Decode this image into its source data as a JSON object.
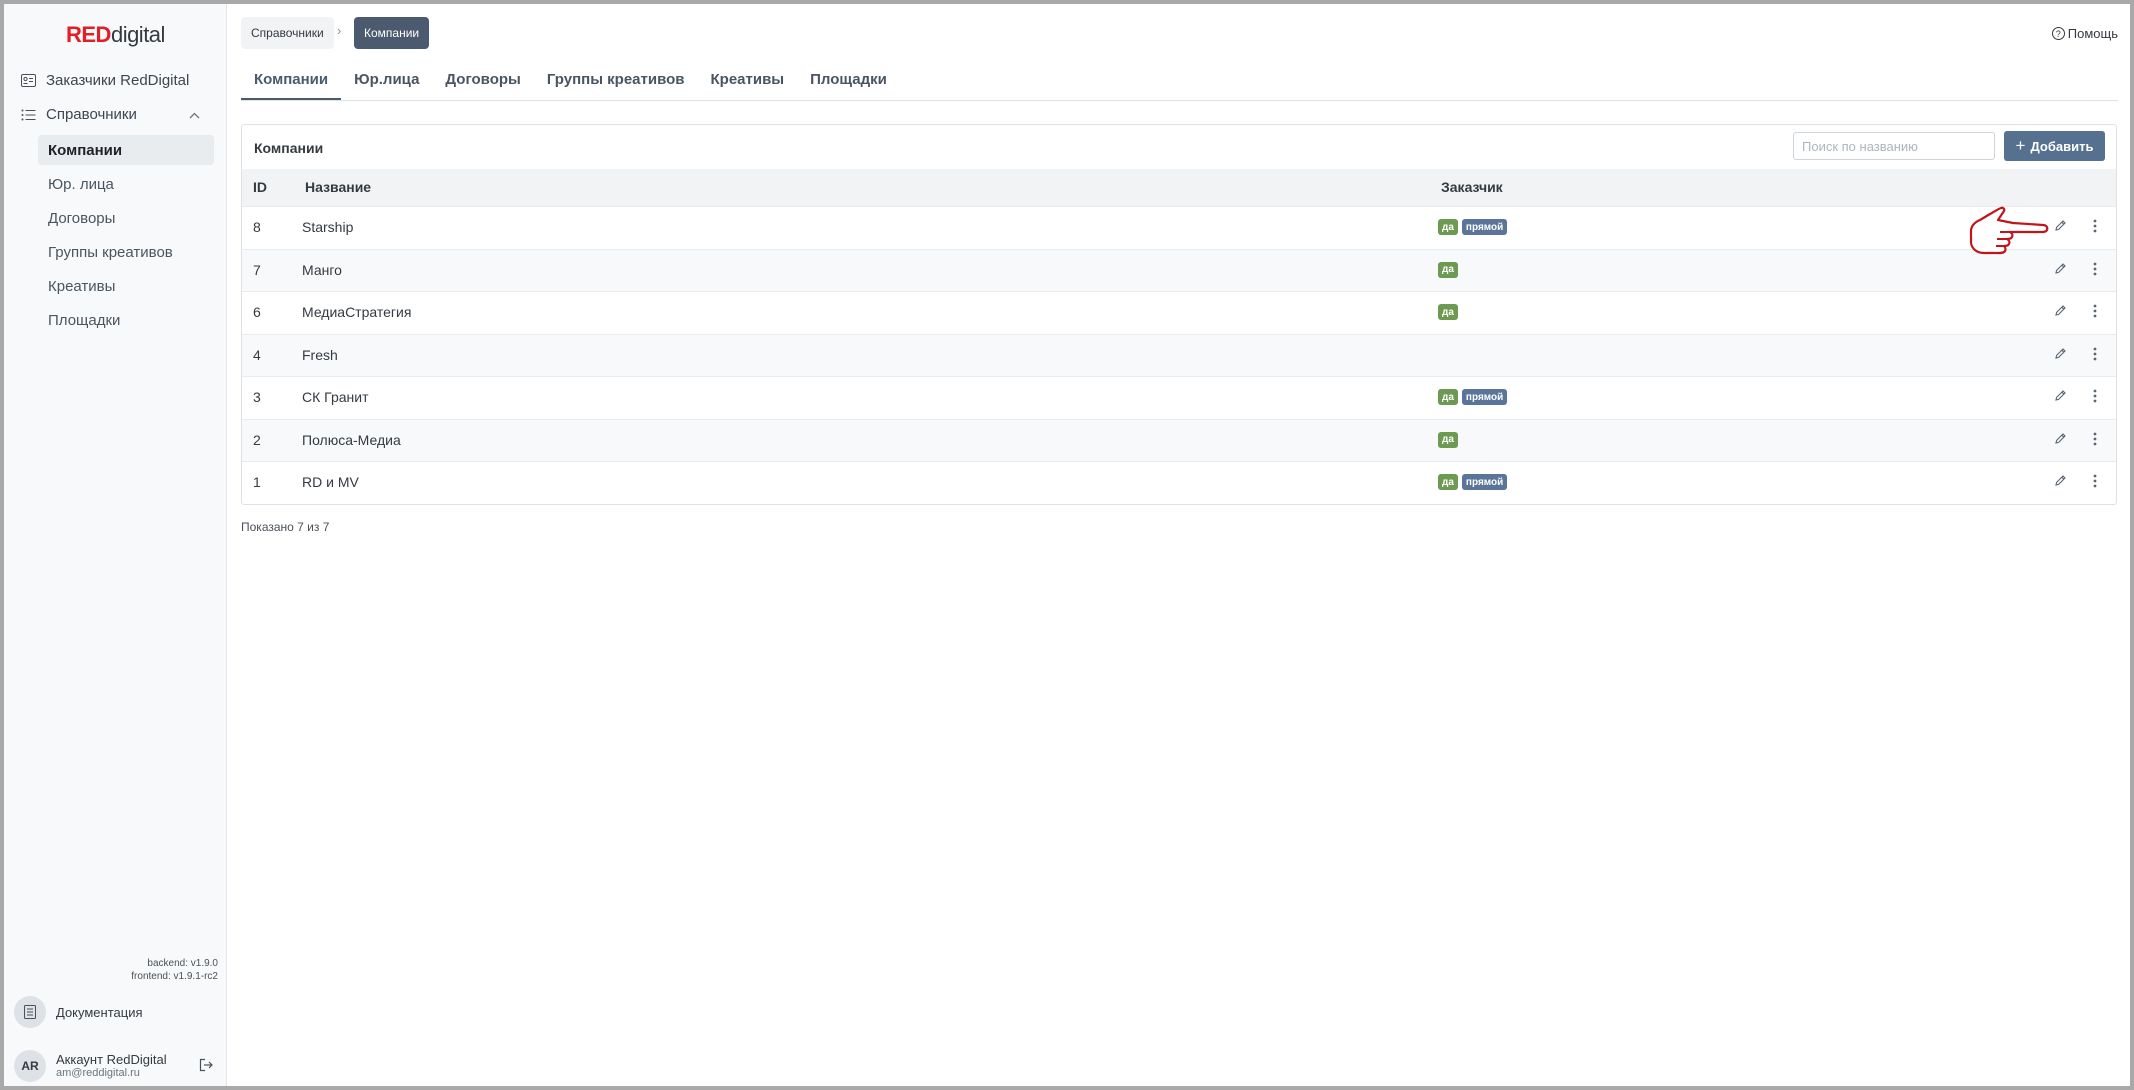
{
  "app": {
    "logo_red": "RED",
    "logo_rest": "digital"
  },
  "sidebar": {
    "items": [
      {
        "label": "Заказчики RedDigital"
      },
      {
        "label": "Справочники"
      }
    ],
    "sub_items": [
      {
        "label": "Компании"
      },
      {
        "label": "Юр. лица"
      },
      {
        "label": "Договоры"
      },
      {
        "label": "Группы креативов"
      },
      {
        "label": "Креативы"
      },
      {
        "label": "Площадки"
      }
    ],
    "versions": {
      "backend": "backend: v1.9.0",
      "frontend": "frontend: v1.9.1-rc2"
    },
    "docs_label": "Документация",
    "account": {
      "initials": "AR",
      "name": "Аккаунт RedDigital",
      "email": "am@reddigital.ru"
    }
  },
  "header": {
    "breadcrumbs": [
      "Справочники",
      "Компании"
    ],
    "help_label": "Помощь"
  },
  "tabs": [
    "Компании",
    "Юр.лица",
    "Договоры",
    "Группы креативов",
    "Креативы",
    "Площадки"
  ],
  "card": {
    "title": "Компании",
    "search_placeholder": "Поиск по названию",
    "add_label": "Добавить",
    "columns": [
      "ID",
      "Название",
      "Заказчик"
    ],
    "rows": [
      {
        "id": "8",
        "name": "Starship",
        "badges": [
          "да",
          "прямой"
        ]
      },
      {
        "id": "7",
        "name": "Манго",
        "badges": [
          "да"
        ]
      },
      {
        "id": "6",
        "name": "МедиаСтратегия",
        "badges": [
          "да"
        ]
      },
      {
        "id": "4",
        "name": "Fresh",
        "badges": []
      },
      {
        "id": "3",
        "name": "СК Гранит",
        "badges": [
          "да",
          "прямой"
        ]
      },
      {
        "id": "2",
        "name": "Полюса-Медиа",
        "badges": [
          "да"
        ]
      },
      {
        "id": "1",
        "name": "RD и MV",
        "badges": [
          "да",
          "прямой"
        ]
      }
    ]
  },
  "footer": {
    "shown": "Показано 7 из 7"
  },
  "colors": {
    "accent": "#56708f",
    "active_crumb": "#4b5a6e",
    "badge_yes": "#6c9a52",
    "badge_direct": "#5b7499",
    "logo_red": "#e31e24",
    "pointer": "#c0151b"
  }
}
